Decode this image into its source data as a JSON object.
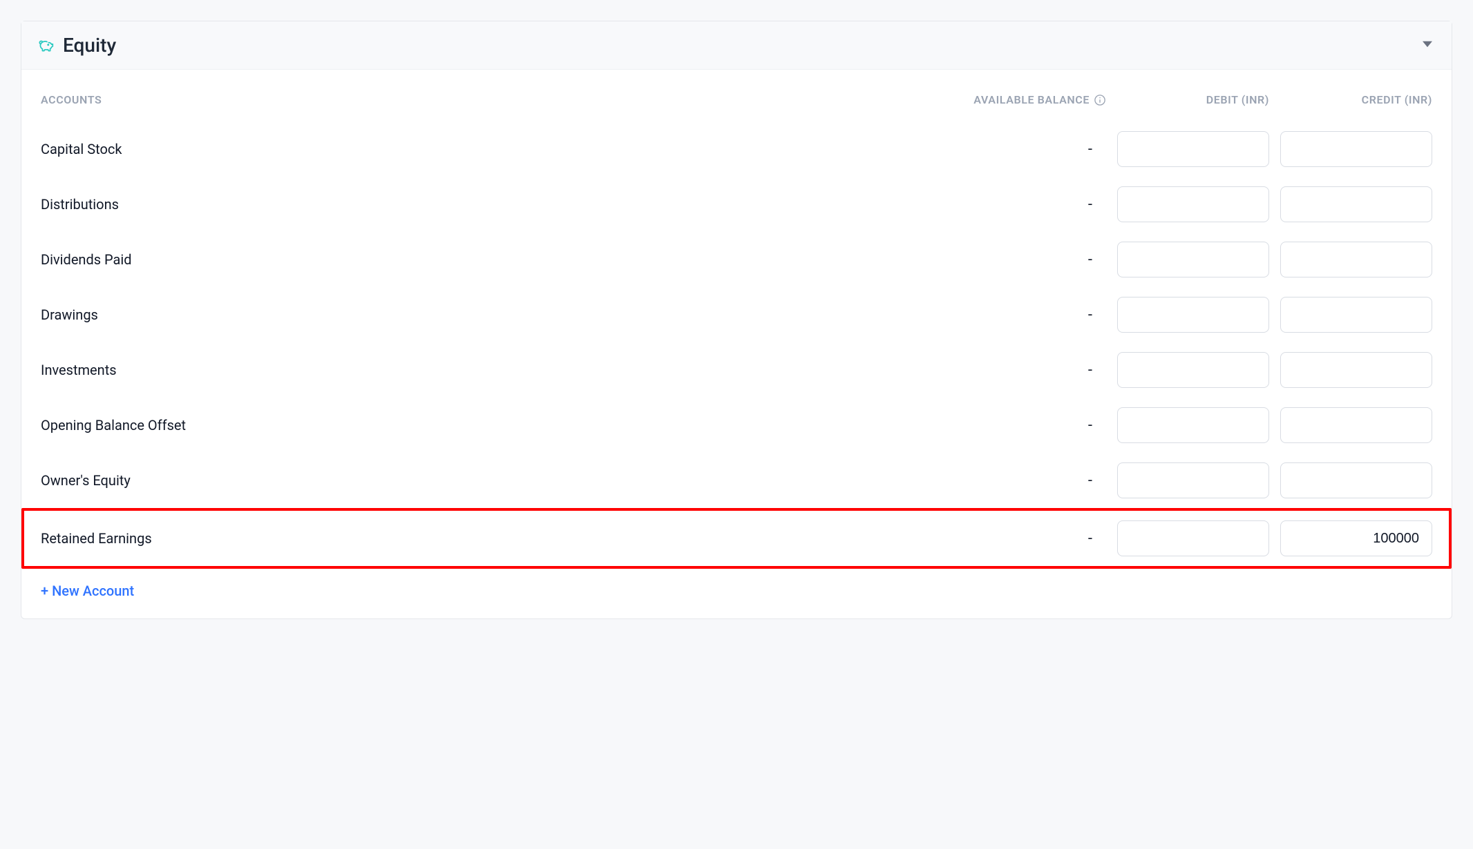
{
  "section": {
    "title": "Equity"
  },
  "headers": {
    "accounts": "ACCOUNTS",
    "available_balance": "AVAILABLE BALANCE",
    "debit": "DEBIT (INR)",
    "credit": "CREDIT (INR)"
  },
  "rows": [
    {
      "name": "Capital Stock",
      "balance": "-",
      "debit": "",
      "credit": "",
      "highlight": false
    },
    {
      "name": "Distributions",
      "balance": "-",
      "debit": "",
      "credit": "",
      "highlight": false
    },
    {
      "name": "Dividends Paid",
      "balance": "-",
      "debit": "",
      "credit": "",
      "highlight": false
    },
    {
      "name": "Drawings",
      "balance": "-",
      "debit": "",
      "credit": "",
      "highlight": false
    },
    {
      "name": "Investments",
      "balance": "-",
      "debit": "",
      "credit": "",
      "highlight": false
    },
    {
      "name": "Opening Balance Offset",
      "balance": "-",
      "debit": "",
      "credit": "",
      "highlight": false
    },
    {
      "name": "Owner's Equity",
      "balance": "-",
      "debit": "",
      "credit": "",
      "highlight": false
    },
    {
      "name": "Retained Earnings",
      "balance": "-",
      "debit": "",
      "credit": "100000",
      "highlight": true
    }
  ],
  "new_account_label": "+ New Account"
}
